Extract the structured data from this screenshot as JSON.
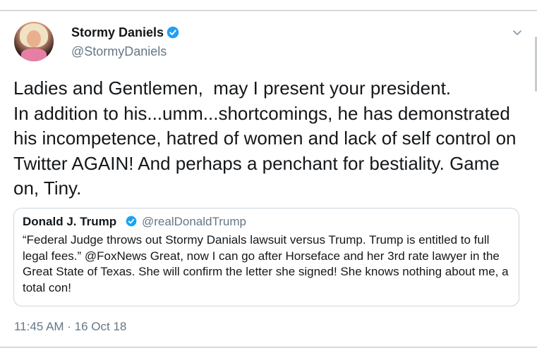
{
  "tweet": {
    "author_name": "Stormy Daniels",
    "author_handle": "@StormyDaniels",
    "text": "Ladies and Gentlemen,  may I present your president.\nIn addition to his...umm...shortcomings, he has demonstrated his incompetence, hatred of women and lack of self control on Twitter AGAIN! And perhaps a penchant for bestiality. Game on, Tiny.",
    "timestamp": "11:45 AM · 16 Oct 18",
    "avatar_icon": "profile-photo",
    "menu_icon": "chevron-down-icon"
  },
  "quote": {
    "author_name": "Donald J. Trump",
    "author_handle": "@realDonaldTrump",
    "text": "“Federal Judge throws out Stormy Danials lawsuit versus Trump. Trump is entitled to full legal fees.” @FoxNews Great, now I can go after Horseface and her 3rd rate lawyer in the Great State of Texas. She will confirm the letter she signed! She knows nothing about me, a total con!"
  },
  "colors": {
    "verified": "#1da1f2",
    "secondary_text": "#657786",
    "border": "#ccd6dd"
  }
}
